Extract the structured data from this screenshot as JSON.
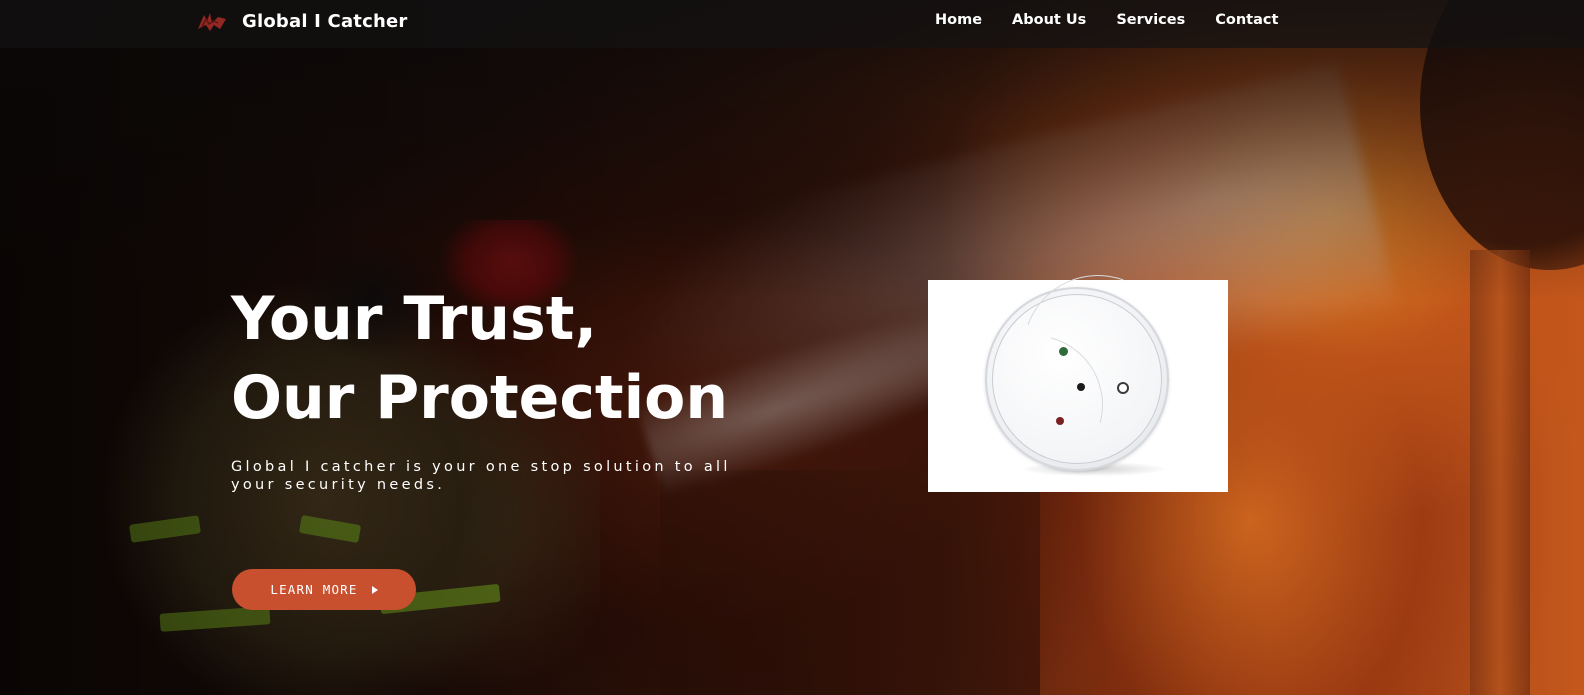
{
  "navbar": {
    "brand_name": "Global I Catcher",
    "links": [
      {
        "label": "Home"
      },
      {
        "label": "About Us"
      },
      {
        "label": "Services"
      },
      {
        "label": "Contact"
      }
    ]
  },
  "hero": {
    "headline_line1": "Your Trust,",
    "headline_line2": "Our Protection",
    "tagline": "Global I catcher is your one stop solution to all your security needs.",
    "cta_label": "LEARN MORE",
    "cta_icon": "caret-right-icon"
  },
  "product_image": {
    "subject": "smoke-detector"
  },
  "colors": {
    "accent": "#c9502f",
    "text": "#ffffff",
    "navbar_bg": "#141212"
  }
}
